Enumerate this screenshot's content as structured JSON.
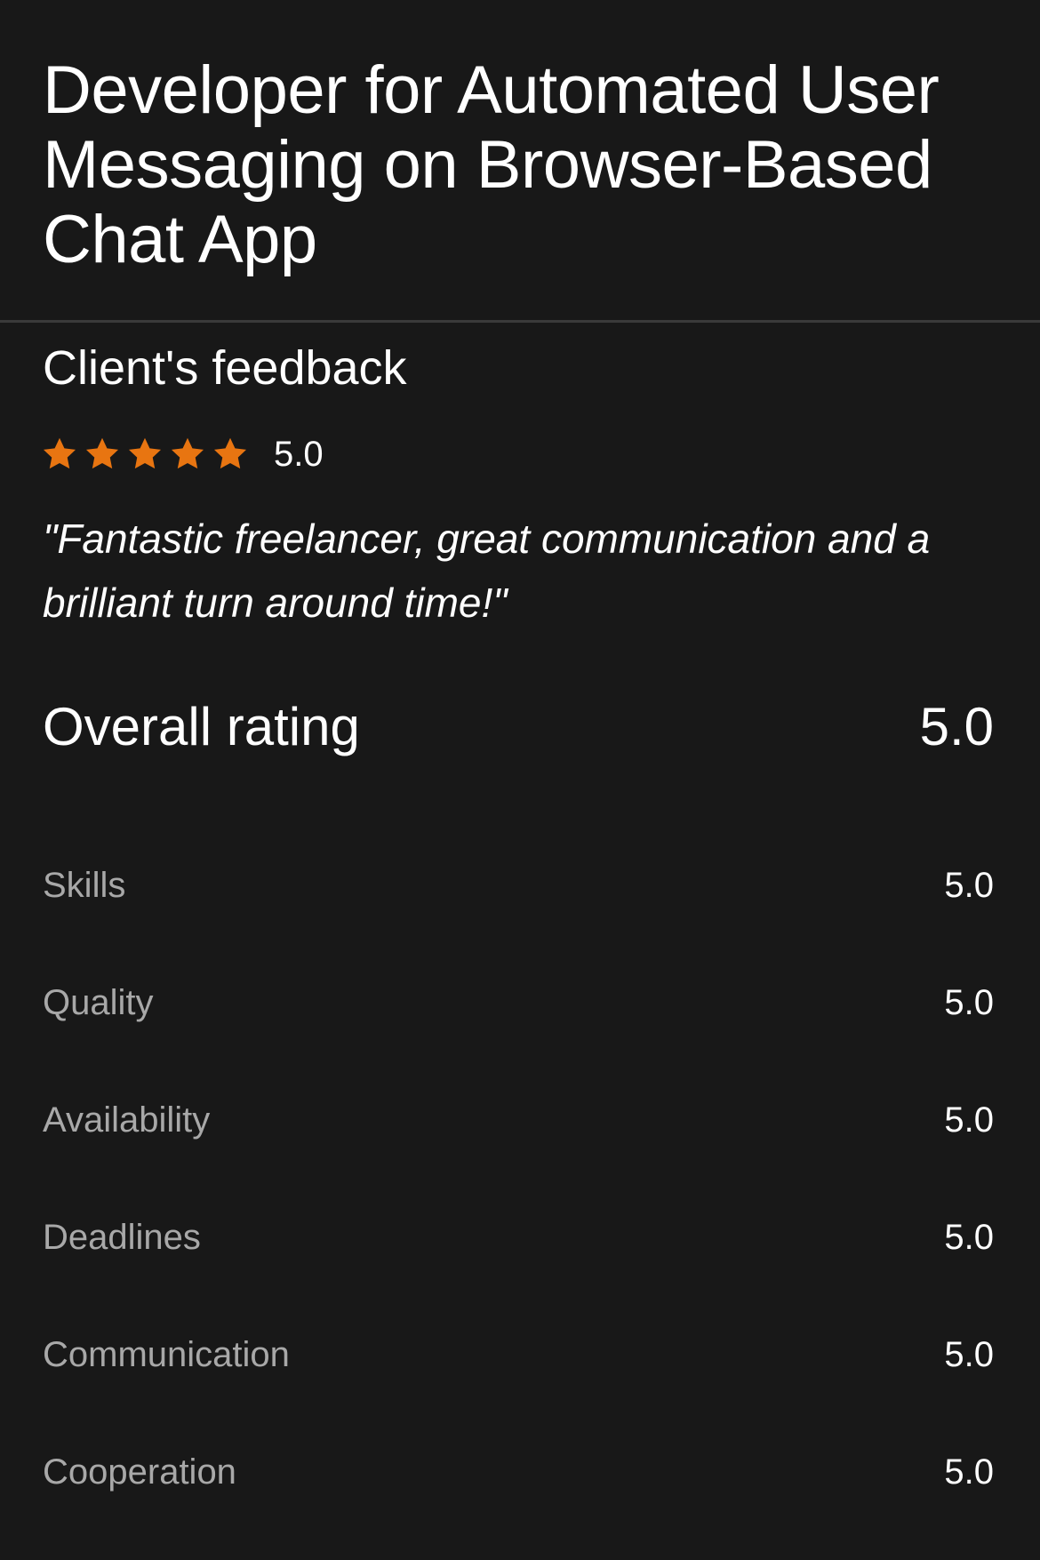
{
  "title": "Developer for Automated User Messaging on Browser-Based Chat App",
  "feedback": {
    "heading": "Client's feedback",
    "stars": 5,
    "star_icon": "star-icon",
    "star_color": "#E87511",
    "rating_value": "5.0",
    "quote": "\"Fantastic freelancer, great communication and a brilliant turn around time!\""
  },
  "overall": {
    "label": "Overall rating",
    "value": "5.0"
  },
  "ratings": [
    {
      "label": "Skills",
      "value": "5.0"
    },
    {
      "label": "Quality",
      "value": "5.0"
    },
    {
      "label": "Availability",
      "value": "5.0"
    },
    {
      "label": "Deadlines",
      "value": "5.0"
    },
    {
      "label": "Communication",
      "value": "5.0"
    },
    {
      "label": "Cooperation",
      "value": "5.0"
    }
  ],
  "colors": {
    "background": "#181818",
    "text": "#FFFFFF",
    "muted_text": "#A8A8A8",
    "divider": "#3A3A3A",
    "star": "#E87511"
  }
}
